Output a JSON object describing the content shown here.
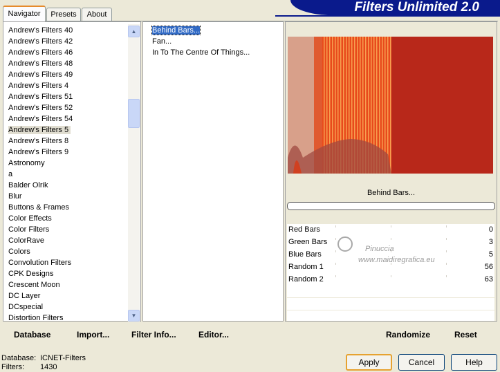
{
  "tabs": [
    "Navigator",
    "Presets",
    "About"
  ],
  "banner": "Filters Unlimited 2.0",
  "categories": [
    "Andrew's Filters 40",
    "Andrew's Filters 42",
    "Andrew's Filters 46",
    "Andrew's Filters 48",
    "Andrew's Filters 49",
    "Andrew's Filters 4",
    "Andrew's Filters 51",
    "Andrew's Filters 52",
    "Andrew's Filters 54",
    "Andrew's Filters 5",
    "Andrew's Filters 8",
    "Andrew's Filters 9",
    "Astronomy",
    "a",
    "Balder Olrik",
    "Blur",
    "Buttons & Frames",
    "Color Effects",
    "Color Filters",
    "ColorRave",
    "Colors",
    "Convolution Filters",
    "CPK Designs",
    "Crescent Moon",
    "DC Layer",
    "DCspecial",
    "Distortion Filters"
  ],
  "selected_category": "Andrew's Filters 5",
  "filters": [
    "Behind Bars...",
    "Fan...",
    "In To The Centre Of Things..."
  ],
  "selected_filter": "Behind Bars...",
  "preview_title": "Behind Bars...",
  "parameters": [
    {
      "name": "Red Bars",
      "value": "0"
    },
    {
      "name": "Green Bars",
      "value": "3"
    },
    {
      "name": "Blue Bars",
      "value": "5"
    },
    {
      "name": "Random 1",
      "value": "56"
    },
    {
      "name": "Random 2",
      "value": "63"
    }
  ],
  "watermark": {
    "name": "Pinuccia",
    "url": "www.maidiregrafica.eu"
  },
  "bottom_links": {
    "database": "Database",
    "import": "Import...",
    "filter_info": "Filter Info...",
    "editor": "Editor...",
    "randomize": "Randomize",
    "reset": "Reset"
  },
  "status": {
    "database_label": "Database:",
    "database_value": "ICNET-Filters",
    "filters_label": "Filters:",
    "filters_value": "1430"
  },
  "buttons": {
    "apply": "Apply",
    "cancel": "Cancel",
    "help": "Help"
  },
  "colors": {
    "banner": "#0a1a8c",
    "selection": "#316ac5",
    "tab_accent": "#e68b2c",
    "preview_red": "#c0301c"
  }
}
